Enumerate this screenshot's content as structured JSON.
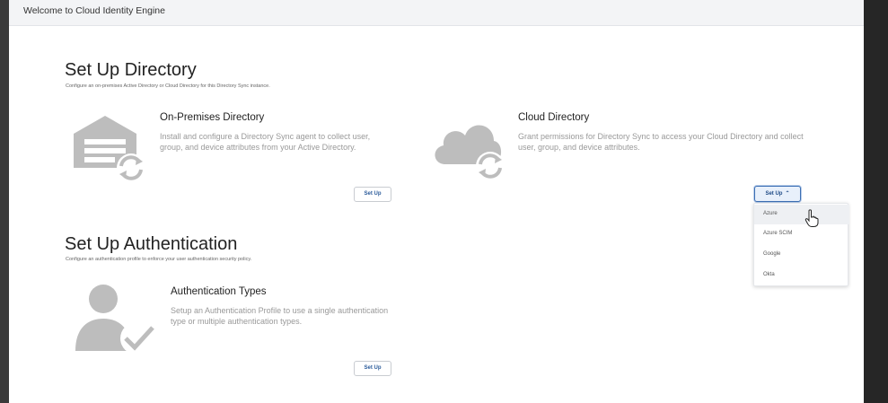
{
  "topbar": {
    "title": "Welcome to Cloud Identity Engine"
  },
  "directory": {
    "title": "Set Up Directory",
    "subtitle": "Configure an on-premises Active Directory or Cloud Directory for this Directory Sync instance.",
    "on_prem": {
      "title": "On-Premises Directory",
      "description": "Install and configure a Directory Sync agent to collect user, group, and device attributes from your Active Directory.",
      "button_label": "Set Up",
      "icon": "garage-sync-icon"
    },
    "cloud": {
      "title": "Cloud Directory",
      "description": "Grant permissions for Directory Sync to access your Cloud Directory and collect user, group, and device attributes.",
      "button_label": "Set Up",
      "icon": "cloud-sync-icon",
      "dropdown": [
        "Azure",
        "Azure SCIM",
        "Google",
        "Okta"
      ]
    }
  },
  "authentication": {
    "title": "Set Up Authentication",
    "subtitle": "Configure an authentication profile to enforce your user authentication security policy.",
    "types": {
      "title": "Authentication Types",
      "description": "Setup an Authentication Profile to use a single authentication type or multiple authentication types.",
      "button_label": "Set Up",
      "icon": "user-check-icon"
    }
  },
  "colors": {
    "icon_gray": "#bdbdbd",
    "accent": "#3c6fb4"
  }
}
